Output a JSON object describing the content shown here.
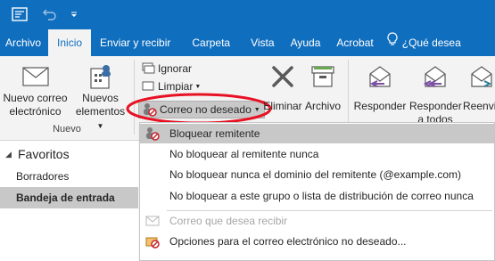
{
  "quick_access": {
    "icons": [
      "send-receive-icon",
      "undo-icon",
      "customize-qat-icon"
    ]
  },
  "tabs": [
    {
      "label": "Archivo",
      "active": false
    },
    {
      "label": "Inicio",
      "active": true
    },
    {
      "label": "Enviar y recibir",
      "active": false
    },
    {
      "label": "Carpeta",
      "active": false
    },
    {
      "label": "Vista",
      "active": false
    },
    {
      "label": "Ayuda",
      "active": false
    },
    {
      "label": "Acrobat",
      "active": false
    },
    {
      "label": "¿Qué desea",
      "active": false
    }
  ],
  "ribbon": {
    "nuevo_correo_l1": "Nuevo correo",
    "nuevo_correo_l2": "electrónico",
    "nuevos_elementos_l1": "Nuevos",
    "nuevos_elementos_l2": "elementos",
    "group_nuevo": "Nuevo",
    "ignorar": "Ignorar",
    "limpiar": "Limpiar",
    "correo_no_deseado": "Correo no deseado",
    "eliminar": "Eliminar",
    "archivo": "Archivo",
    "responder": "Responder",
    "responder_todos_l1": "Responder",
    "responder_todos_l2": "a todos",
    "reenviar": "Reenvi"
  },
  "nav": {
    "favoritos": "Favoritos",
    "borradores": "Borradores",
    "bandeja": "Bandeja de entrada"
  },
  "menu": {
    "bloquear_remitente": "Bloquear remitente",
    "no_bloquear_remitente": "No bloquear al remitente nunca",
    "no_bloquear_dominio": "No bloquear nunca el dominio del remitente (@example.com)",
    "no_bloquear_grupo": "No bloquear a este grupo o lista de distribución de correo nunca",
    "correo_desea_recibir": "Correo que desea recibir",
    "opciones": "Opciones para el correo electrónico no deseado..."
  },
  "colors": {
    "brand": "#106ebe",
    "highlight_oval": "#e81123",
    "menu_highlight": "#c8c8c8"
  }
}
